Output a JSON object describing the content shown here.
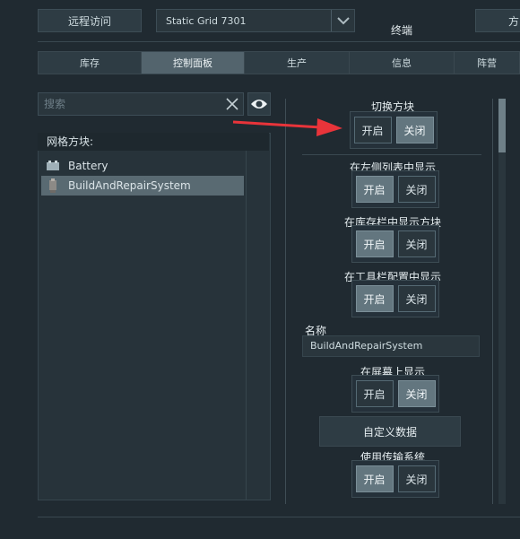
{
  "header": {
    "remote_access_label": "远程访问",
    "grid_select_value": "Static Grid 7301",
    "title": "终端",
    "right_partial_label": "方"
  },
  "tabs": [
    {
      "label": "库存"
    },
    {
      "label": "控制面板"
    },
    {
      "label": "生产"
    },
    {
      "label": "信息"
    },
    {
      "label": "阵营"
    }
  ],
  "search": {
    "placeholder": "搜索",
    "value": ""
  },
  "block_list": {
    "header": "网格方块:",
    "items": [
      {
        "label": "Battery",
        "icon": "battery-icon"
      },
      {
        "label": "BuildAndRepairSystem",
        "icon": "welder-icon"
      }
    ]
  },
  "controls": {
    "toggle_block": {
      "label": "切换方块",
      "on": "开启",
      "off": "关闭",
      "state": "off"
    },
    "show_in_list": {
      "label": "在左侧列表中显示",
      "on": "开启",
      "off": "关闭",
      "state": "on"
    },
    "show_in_inventory": {
      "label": "在库存栏中显示方块",
      "on": "开启",
      "off": "关闭",
      "state": "on"
    },
    "show_in_toolbar": {
      "label": "在工具栏配置中显示",
      "on": "开启",
      "off": "关闭",
      "state": "on"
    },
    "name_label": "名称",
    "name_value": "BuildAndRepairSystem",
    "show_on_hud": {
      "label": "在屏幕上显示",
      "on": "开启",
      "off": "关闭",
      "state": "off"
    },
    "custom_data_label": "自定义数据",
    "use_conveyor": {
      "label": "使用传输系统",
      "on": "开启",
      "off": "关闭",
      "state": "on"
    }
  },
  "colors": {
    "accent_arrow": "#e8343a",
    "active_toggle": "#63767f"
  }
}
